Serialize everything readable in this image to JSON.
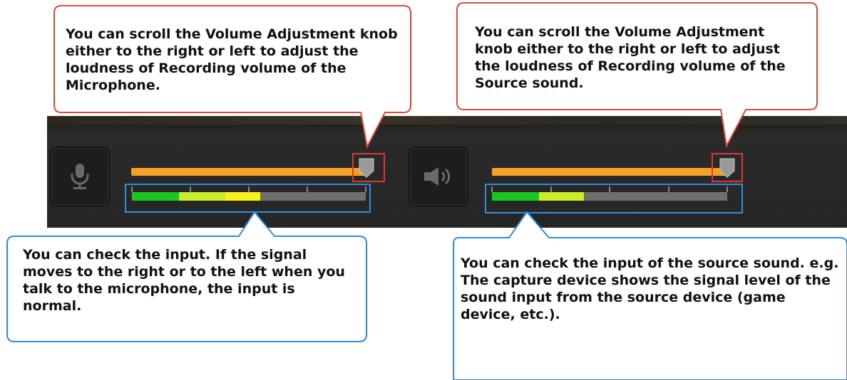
{
  "callouts": {
    "mic_volume": "You can scroll the Volume Adjustment knob either to the right or left to adjust the loudness of Recording volume of the Microphone.",
    "source_volume": "You can scroll the Volume Adjustment knob either to the right or left to adjust the loudness of Recording volume of the Source sound.",
    "mic_input": "You can check the input. If the signal moves to the right or to the left when you talk to the microphone, the input is normal.",
    "source_input": "You can check the input of the source sound. e.g. The capture device shows the signal level of the sound input from the source device (game device, etc.)."
  },
  "controls": {
    "mic": {
      "icon": "microphone-icon",
      "volume_level": 1.0,
      "meter_level": 0.55
    },
    "source": {
      "icon": "speaker-icon",
      "volume_level": 1.0,
      "meter_level": 0.39
    }
  },
  "colors": {
    "volume_track": "#f5a026",
    "meter_green": "#16c81e",
    "meter_yellow_green": "#c8ee2c",
    "meter_yellow": "#f5f51c",
    "meter_empty": "#6f6f6f",
    "highlight_red": "#e1372c",
    "highlight_blue": "#2f8fde",
    "callout_border_red": "#e04b3c",
    "callout_border_blue": "#2f8fde"
  }
}
